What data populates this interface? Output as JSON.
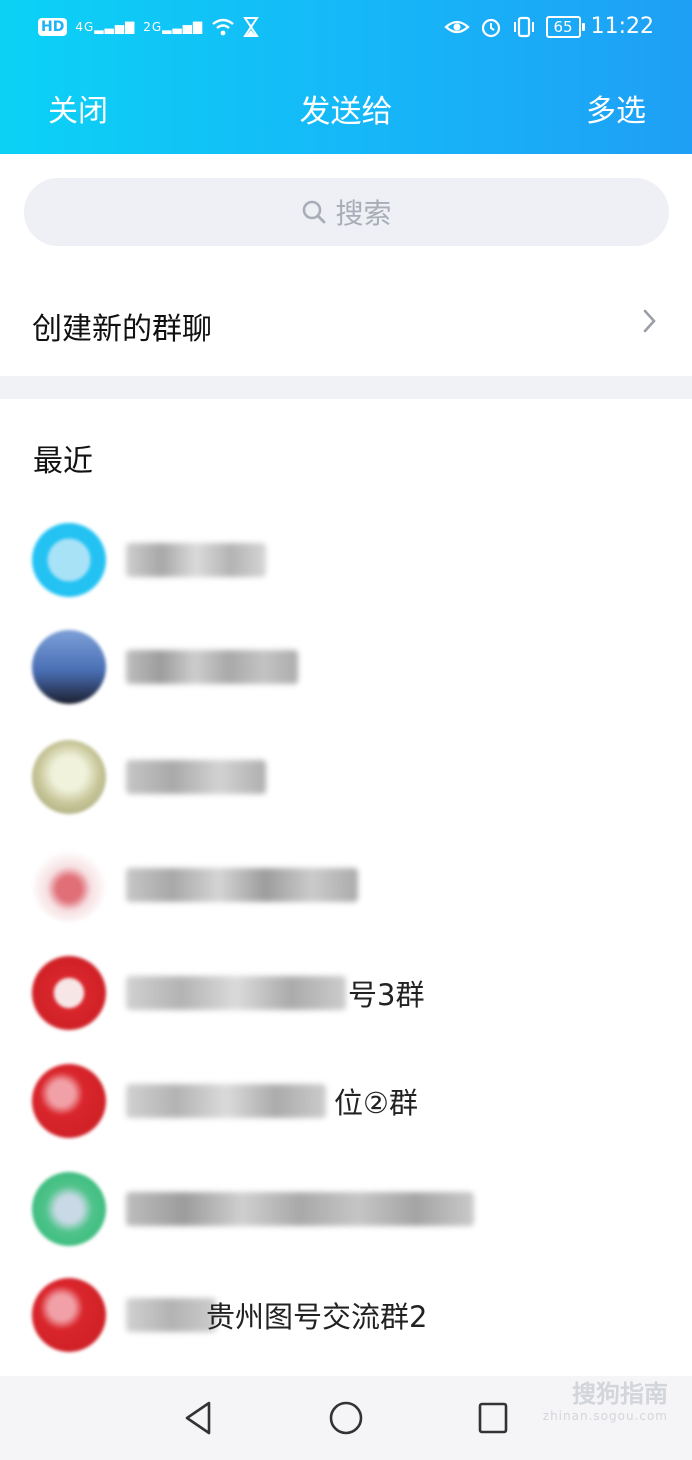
{
  "status_bar": {
    "hd": "HD",
    "sig1": "4G",
    "sig2": "2G",
    "battery": "65",
    "time": "11:22"
  },
  "nav": {
    "close": "关闭",
    "title": "发送给",
    "multi_select": "多选"
  },
  "search": {
    "placeholder": "搜索"
  },
  "create_group": {
    "label": "创建新的群聊"
  },
  "recent": {
    "title": "最近",
    "contacts": [
      {
        "name_suffix": ""
      },
      {
        "name_suffix": ""
      },
      {
        "name_suffix": ""
      },
      {
        "name_suffix": ""
      },
      {
        "name_suffix": "号3群"
      },
      {
        "name_suffix": "位②群"
      },
      {
        "name_suffix": ""
      },
      {
        "name_suffix": "贵州图号交流群2"
      }
    ]
  },
  "watermark": {
    "text": "搜狗指南",
    "url": "zhinan.sogou.com"
  },
  "colors": {
    "header_start": "#0bd2f5",
    "header_end": "#1f9ff5",
    "search_bg": "#eef0f5"
  }
}
